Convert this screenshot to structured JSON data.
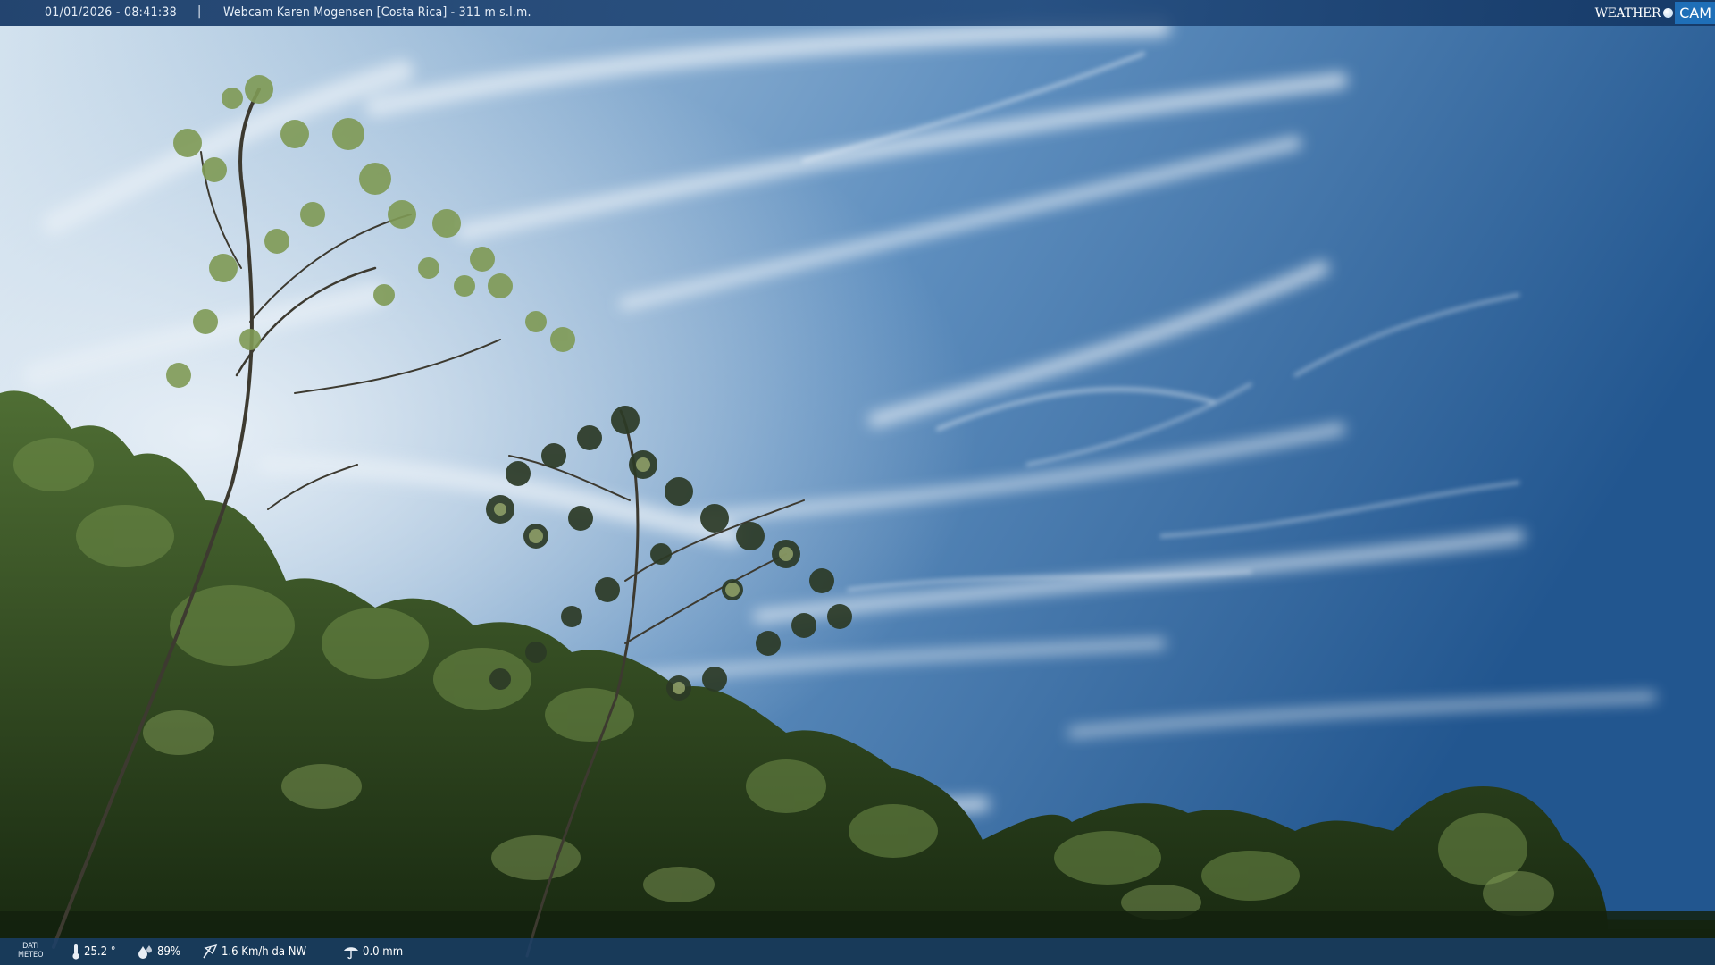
{
  "header": {
    "timestamp": "01/01/2026 - 08:41:38",
    "separator": "|",
    "camera_title": "Webcam Karen Mogensen [Costa Rica] - 311 m s.l.m."
  },
  "logo": {
    "weather_text": "WEATHER",
    "cam_text": "CAM"
  },
  "footer": {
    "label_line1": "DATI",
    "label_line2": "METEO",
    "temperature": "25.2 °",
    "humidity": "89%",
    "wind": "1.6 Km/h da NW",
    "rain": "0.0 mm"
  },
  "colors": {
    "bar": "#1e4a7a",
    "logo_accent": "#1f6fb8",
    "sky_light": "#cfe0ee",
    "sky_deep": "#1f5590"
  },
  "icons": {
    "temperature": "thermometer-icon",
    "humidity": "humidity-drop-icon",
    "wind": "wind-icon",
    "rain": "rain-icon"
  }
}
